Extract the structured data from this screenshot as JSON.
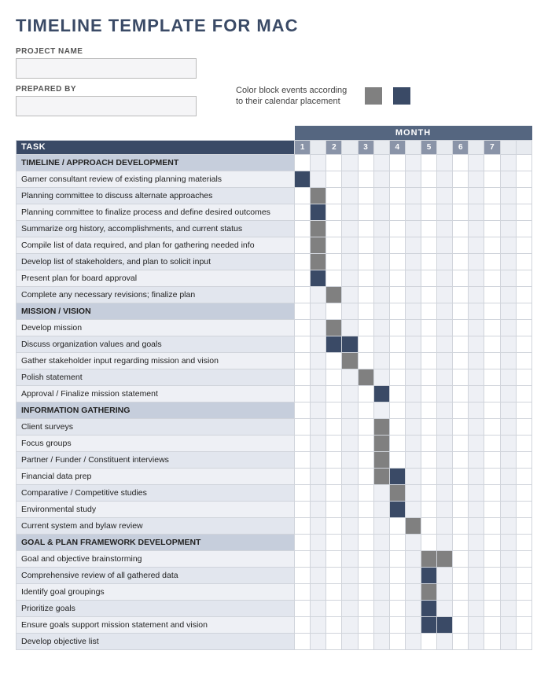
{
  "title": "TIMELINE TEMPLATE FOR MAC",
  "meta": {
    "project_name_label": "PROJECT NAME",
    "project_name_value": "",
    "prepared_by_label": "PREPARED BY",
    "prepared_by_value": ""
  },
  "legend": {
    "text": "Color block events according to their calendar placement",
    "colors": [
      "#808080",
      "#3a4a66"
    ]
  },
  "month_header": "MONTH",
  "task_header": "TASK",
  "months": [
    "1",
    "2",
    "3",
    "4",
    "5",
    "6",
    "7"
  ],
  "rows": [
    {
      "type": "section",
      "label": "TIMELINE / APPROACH DEVELOPMENT"
    },
    {
      "type": "task",
      "label": "Garner consultant review of existing planning materials",
      "fills": {
        "0": "navy"
      }
    },
    {
      "type": "task",
      "label": "Planning committee to discuss alternate approaches",
      "fills": {
        "1": "gray"
      }
    },
    {
      "type": "task",
      "label": "Planning committee to finalize process and define desired outcomes",
      "fills": {
        "1": "navy"
      }
    },
    {
      "type": "task",
      "label": "Summarize org history, accomplishments, and current status",
      "fills": {
        "1": "gray"
      }
    },
    {
      "type": "task",
      "label": "Compile list of data required, and plan for gathering needed info",
      "fills": {
        "1": "gray"
      }
    },
    {
      "type": "task",
      "label": "Develop list of stakeholders, and plan to solicit input",
      "fills": {
        "1": "gray"
      }
    },
    {
      "type": "task",
      "label": "Present plan for board approval",
      "fills": {
        "1": "navy"
      }
    },
    {
      "type": "task",
      "label": "Complete any necessary revisions; finalize plan",
      "fills": {
        "2": "gray"
      }
    },
    {
      "type": "section",
      "label": "MISSION / VISION"
    },
    {
      "type": "task",
      "label": "Develop mission",
      "fills": {
        "2": "gray"
      }
    },
    {
      "type": "task",
      "label": "Discuss organization values and goals",
      "fills": {
        "2": "navy",
        "3": "navy"
      }
    },
    {
      "type": "task",
      "label": "Gather stakeholder input regarding mission and vision",
      "fills": {
        "3": "gray"
      }
    },
    {
      "type": "task",
      "label": "Polish statement",
      "fills": {
        "4": "gray"
      }
    },
    {
      "type": "task",
      "label": "Approval / Finalize mission statement",
      "fills": {
        "5": "navy"
      }
    },
    {
      "type": "section",
      "label": "INFORMATION GATHERING"
    },
    {
      "type": "task",
      "label": "Client surveys",
      "fills": {
        "5": "gray"
      }
    },
    {
      "type": "task",
      "label": "Focus groups",
      "fills": {
        "5": "gray"
      }
    },
    {
      "type": "task",
      "label": "Partner / Funder / Constituent interviews",
      "fills": {
        "5": "gray"
      }
    },
    {
      "type": "task",
      "label": "Financial data prep",
      "fills": {
        "5": "gray",
        "6": "navy"
      }
    },
    {
      "type": "task",
      "label": "Comparative / Competitive studies",
      "fills": {
        "6": "gray"
      }
    },
    {
      "type": "task",
      "label": "Environmental study",
      "fills": {
        "6": "navy"
      }
    },
    {
      "type": "task",
      "label": "Current system and bylaw review",
      "fills": {
        "7": "gray"
      }
    },
    {
      "type": "section",
      "label": "GOAL & PLAN FRAMEWORK DEVELOPMENT"
    },
    {
      "type": "task",
      "label": "Goal and objective brainstorming",
      "fills": {
        "8": "gray",
        "9": "gray"
      }
    },
    {
      "type": "task",
      "label": "Comprehensive review of all gathered data",
      "fills": {
        "8": "navy"
      }
    },
    {
      "type": "task",
      "label": "Identify goal groupings",
      "fills": {
        "8": "gray"
      }
    },
    {
      "type": "task",
      "label": "Prioritize goals",
      "fills": {
        "8": "navy"
      }
    },
    {
      "type": "task",
      "label": "Ensure goals support mission statement and vision",
      "fills": {
        "8": "navy",
        "9": "navy"
      }
    },
    {
      "type": "task",
      "label": "Develop objective list",
      "fills": {}
    }
  ],
  "columns": 15
}
